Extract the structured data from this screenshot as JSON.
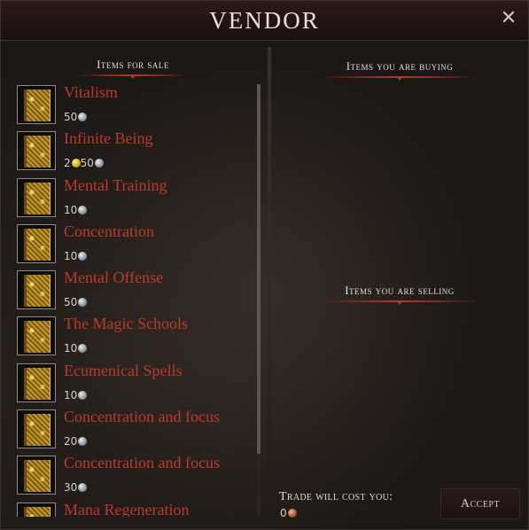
{
  "window": {
    "title": "VENDOR",
    "close_glyph": "✕",
    "close_icon": "close-icon"
  },
  "sections": {
    "for_sale": "Items for sale",
    "buying": "Items you are buying",
    "selling": "Items you are selling"
  },
  "items": [
    {
      "name": "Vitalism",
      "price_parts": [
        {
          "amount": "50",
          "coin": "silver"
        }
      ]
    },
    {
      "name": "Infinite Being",
      "price_parts": [
        {
          "amount": "2",
          "coin": "gold"
        },
        {
          "amount": "50",
          "coin": "silver"
        }
      ]
    },
    {
      "name": "Mental Training",
      "price_parts": [
        {
          "amount": "10",
          "coin": "silver"
        }
      ]
    },
    {
      "name": "Concentration",
      "price_parts": [
        {
          "amount": "10",
          "coin": "silver"
        }
      ]
    },
    {
      "name": "Mental Offense",
      "price_parts": [
        {
          "amount": "50",
          "coin": "silver"
        }
      ]
    },
    {
      "name": "The Magic Schools",
      "price_parts": [
        {
          "amount": "10",
          "coin": "silver"
        }
      ]
    },
    {
      "name": "Ecumenical Spells",
      "price_parts": [
        {
          "amount": "10",
          "coin": "silver"
        }
      ]
    },
    {
      "name": "Concentration and focus",
      "price_parts": [
        {
          "amount": "20",
          "coin": "silver"
        }
      ]
    },
    {
      "name": "Concentration and focus",
      "price_parts": [
        {
          "amount": "30",
          "coin": "silver"
        }
      ]
    },
    {
      "name": "Mana Regeneration",
      "price_parts": []
    }
  ],
  "trade": {
    "label": "Trade will cost you:",
    "amount": "0",
    "coin": "copper"
  },
  "accept_label": "Accept",
  "colors": {
    "item_name": "#b93a2c",
    "accent_rule": "#8c2b22"
  }
}
